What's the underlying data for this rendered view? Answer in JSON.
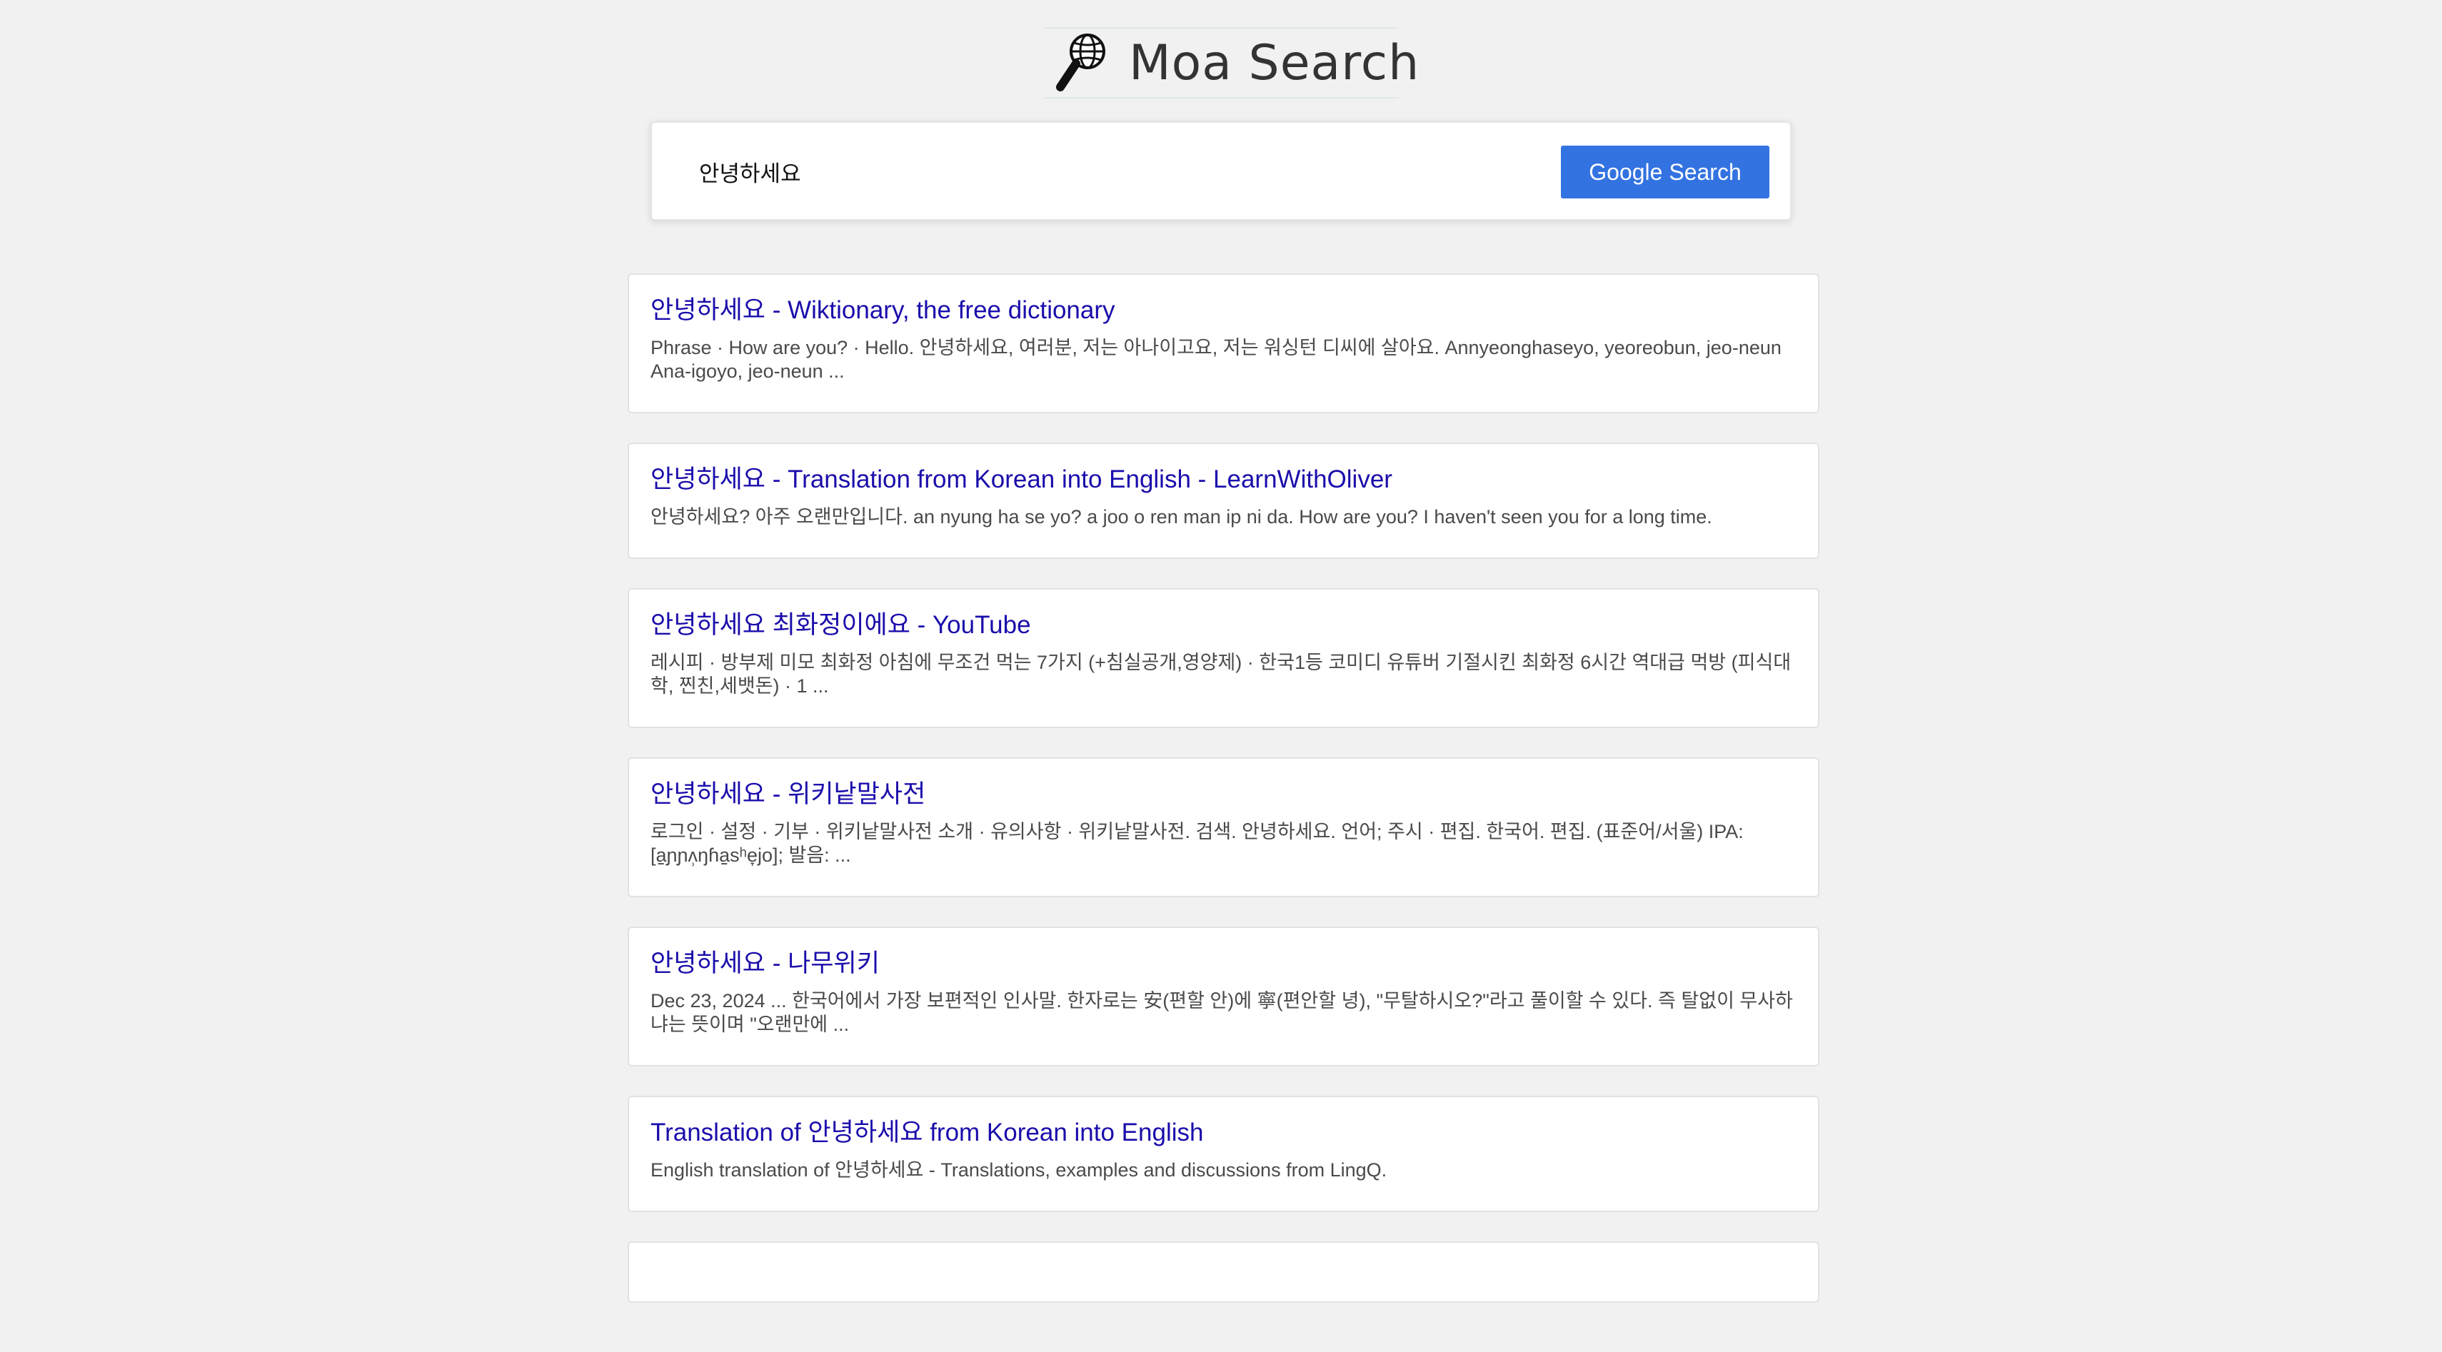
{
  "header": {
    "logo_icon": "globe-magnifier-icon",
    "title": "Moa Search"
  },
  "search": {
    "query": "안녕하세요",
    "button_label": "Google Search"
  },
  "colors": {
    "background": "#f1f1f1",
    "button": "#3373e1",
    "link": "#1a0dab",
    "snippet": "#4a4a4a"
  },
  "results": [
    {
      "title": "안녕하세요 - Wiktionary, the free dictionary",
      "snippet": "Phrase · How are you? · Hello. 안녕하세요, 여러분, 저는 아나이고요, 저는 워싱턴 디씨에 살아요. Annyeonghaseyo, yeoreobun, jeo-neun Ana-igoyo, jeo-neun ..."
    },
    {
      "title": "안녕하세요 - Translation from Korean into English - LearnWithOliver",
      "snippet": "안녕하세요? 아주 오랜만입니다. an nyung ha se yo? a joo o ren man ip ni da. How are you? I haven't seen you for a long time."
    },
    {
      "title": "안녕하세요 최화정이에요 - YouTube",
      "snippet": "레시피 · 방부제 미모 최화정 아침에 무조건 먹는 7가지 (+침실공개,영양제) · 한국1등 코미디 유튜버 기절시킨 최화정 6시간 역대급 먹방 (피식대학, 찐친,세뱃돈) · 1 ..."
    },
    {
      "title": "안녕하세요 - 위키낱말사전",
      "snippet": "로그인 · 설정 · 기부 · 위키낱말사전 소개 · 유의사항 · 위키낱말사전. 검색. 안녕하세요. 언어; 주시 · 편집. 한국어. 편집. (표준어/서울) IPA: [a̠ɲɲʌ̹ŋɦa̠sʰe̞jo]; 발음: ..."
    },
    {
      "title": "안녕하세요 - 나무위키",
      "snippet": "Dec 23, 2024 ... 한국어에서 가장 보편적인 인사말. 한자로는 安(편할 안)에 寧(편안할 녕), \"무탈하시오?\"라고 풀이할 수 있다. 즉 탈없이 무사하냐는 뜻이며 \"오랜만에 ..."
    },
    {
      "title": "Translation of 안녕하세요 from Korean into English",
      "snippet": "English translation of 안녕하세요 - Translations, examples and discussions from LingQ."
    },
    {
      "title": "",
      "snippet": ""
    }
  ]
}
